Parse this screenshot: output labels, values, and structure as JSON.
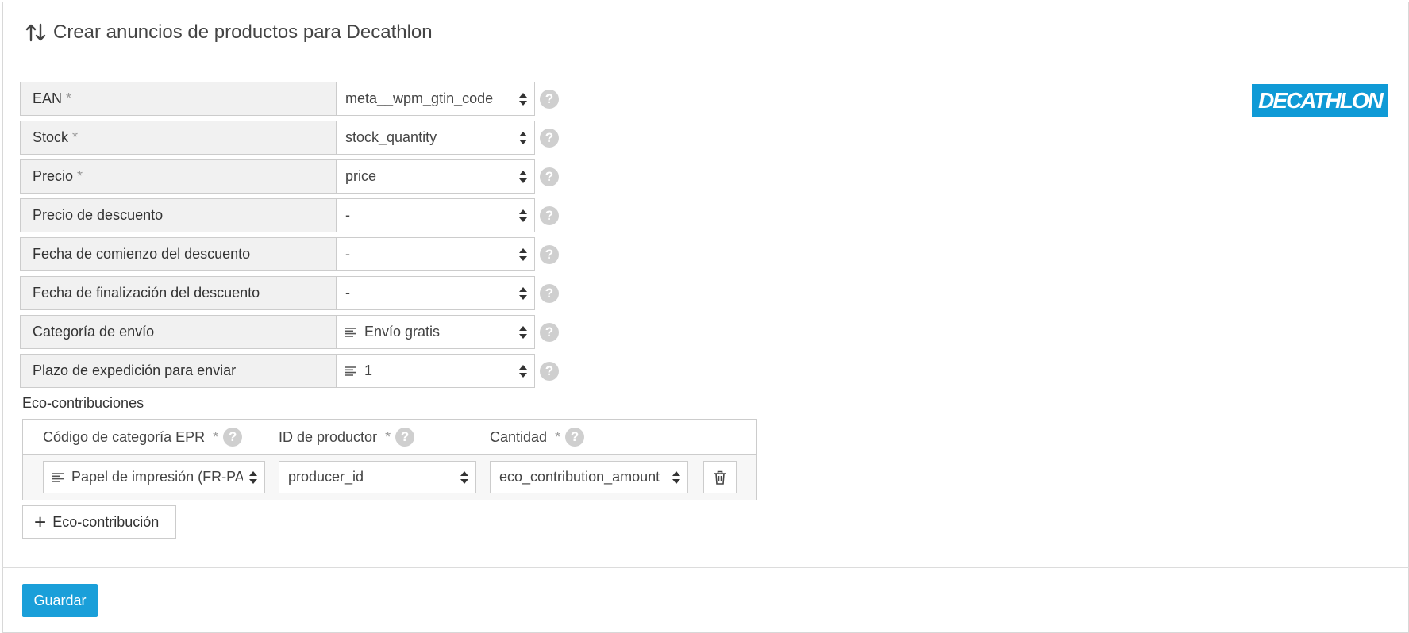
{
  "header": {
    "title": "Crear anuncios de productos para Decathlon"
  },
  "brand": {
    "logo_text": "DECATHLON",
    "accent_color": "#0f9ad6"
  },
  "fields": [
    {
      "label": "EAN",
      "required": "*",
      "value": "meta__wpm_gtin_code",
      "icon": ""
    },
    {
      "label": "Stock",
      "required": "*",
      "value": "stock_quantity",
      "icon": ""
    },
    {
      "label": "Precio",
      "required": "*",
      "value": "price",
      "icon": ""
    },
    {
      "label": "Precio de descuento",
      "required": "",
      "value": "-",
      "icon": ""
    },
    {
      "label": "Fecha de comienzo del descuento",
      "required": "",
      "value": "-",
      "icon": ""
    },
    {
      "label": "Fecha de finalización del descuento",
      "required": "",
      "value": "-",
      "icon": ""
    },
    {
      "label": "Categoría de envío",
      "required": "",
      "value": "Envío gratis",
      "icon": "lines-icon"
    },
    {
      "label": "Plazo de expedición para enviar",
      "required": "",
      "value": "1",
      "icon": "lines-icon"
    }
  ],
  "eco": {
    "title": "Eco-contribuciones",
    "columns": [
      {
        "label": "Código de categoría EPR",
        "required": "*"
      },
      {
        "label": "ID de productor",
        "required": "*"
      },
      {
        "label": "Cantidad",
        "required": "*"
      }
    ],
    "row": {
      "category": "Papel de impresión (FR-PA",
      "producer": "producer_id",
      "amount": "eco_contribution_amount"
    },
    "add_label": "Eco-contribución"
  },
  "help_glyph": "?",
  "save_label": "Guardar"
}
